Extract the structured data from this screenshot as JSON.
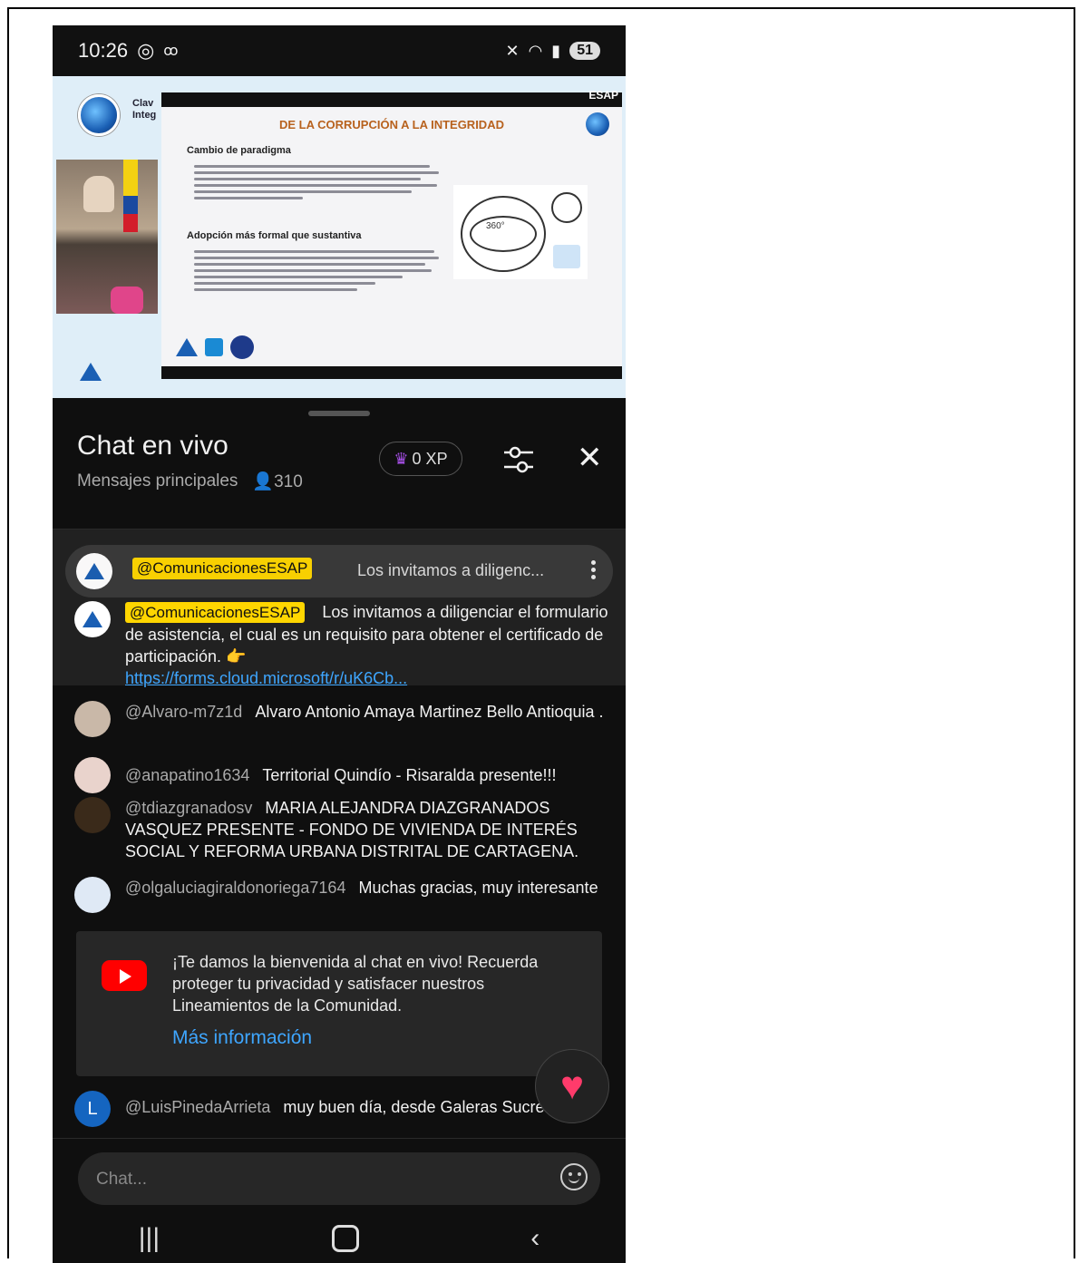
{
  "status_bar": {
    "time": "10:26",
    "left_icons": "whatsapp-icon voicemail-icon",
    "battery": "51"
  },
  "video": {
    "slide_title": "DE LA CORRUPCIÓN A LA INTEGRIDAD",
    "section1": "Cambio de paradigma",
    "section2": "Adopción más formal que sustantiva",
    "diagram_label": "360°",
    "stage_brand": "ESAP"
  },
  "chat": {
    "title": "Chat en vivo",
    "mode": "Mensajes principales",
    "viewers": "310",
    "xp": "0 XP",
    "pinned": {
      "author": "@ComunicacionesESAP",
      "preview": "Los invitamos a diligenc..."
    },
    "messages": [
      {
        "author": "@ComunicacionesESAP",
        "text": "Los invitamos a diligenciar el formulario de asistencia, el cual es un requisito para obtener el certificado de participación. 👉",
        "link": "https://forms.cloud.microsoft/r/uK6Cb..."
      },
      {
        "author": "@Alvaro-m7z1d",
        "text": "Alvaro Antonio Amaya Martinez Bello Antioquia ."
      },
      {
        "author": "@anapatino1634",
        "text": "Territorial Quindío - Risaralda presente!!!"
      },
      {
        "author": "@tdiazgranadosv",
        "text": "MARIA ALEJANDRA DIAZGRANADOS VASQUEZ PRESENTE - FONDO DE VIVIENDA DE INTERÉS SOCIAL Y REFORMA URBANA DISTRITAL DE CARTAGENA."
      },
      {
        "author": "@olgaluciagiraldonoriega7164",
        "text": "Muchas gracias, muy interesante"
      }
    ],
    "welcome": {
      "text": "¡Te damos la bienvenida al chat en vivo! Recuerda proteger tu privacidad y satisfacer nuestros Lineamientos de la Comunidad.",
      "more": "Más información"
    },
    "last": {
      "initial": "L",
      "author": "@LuisPinedaArrieta",
      "text": "muy buen día, desde Galeras Sucre"
    },
    "input_placeholder": "Chat..."
  },
  "colors": {
    "mention_bg": "#ffd600",
    "link": "#3ea6ff",
    "youtube_red": "#ff0000"
  }
}
